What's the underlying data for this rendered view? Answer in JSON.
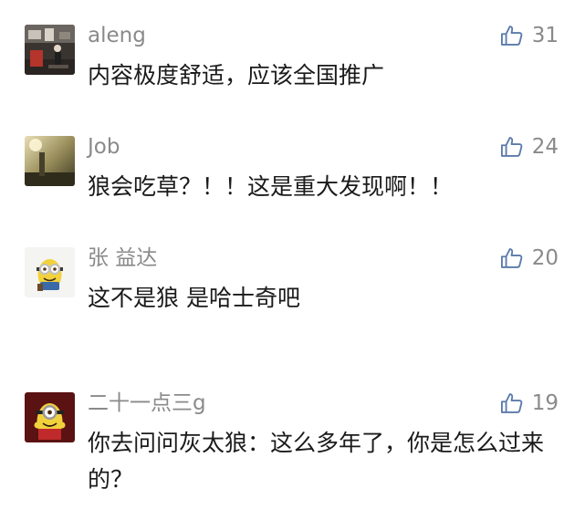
{
  "comments": [
    {
      "name": "aleng",
      "text": "内容极度舒适，应该全国推广",
      "likes": "31",
      "avatar_icon": "street-photo-avatar"
    },
    {
      "name": "Job",
      "text": "狼会吃草？！！这是重大发现啊！！",
      "likes": "24",
      "avatar_icon": "sunset-photo-avatar"
    },
    {
      "name": "张 益达",
      "text": "这不是狼 是哈士奇吧",
      "likes": "20",
      "avatar_icon": "minion-avatar"
    },
    {
      "name": "二十一点三g",
      "text": "你去问问灰太狼：这么多年了，你是怎么过来的？",
      "likes": "19",
      "avatar_icon": "minion-red-avatar"
    }
  ],
  "colors": {
    "meta": "#8a8a8a",
    "text": "#1a1a1a",
    "like_icon": "#5b7bab"
  }
}
